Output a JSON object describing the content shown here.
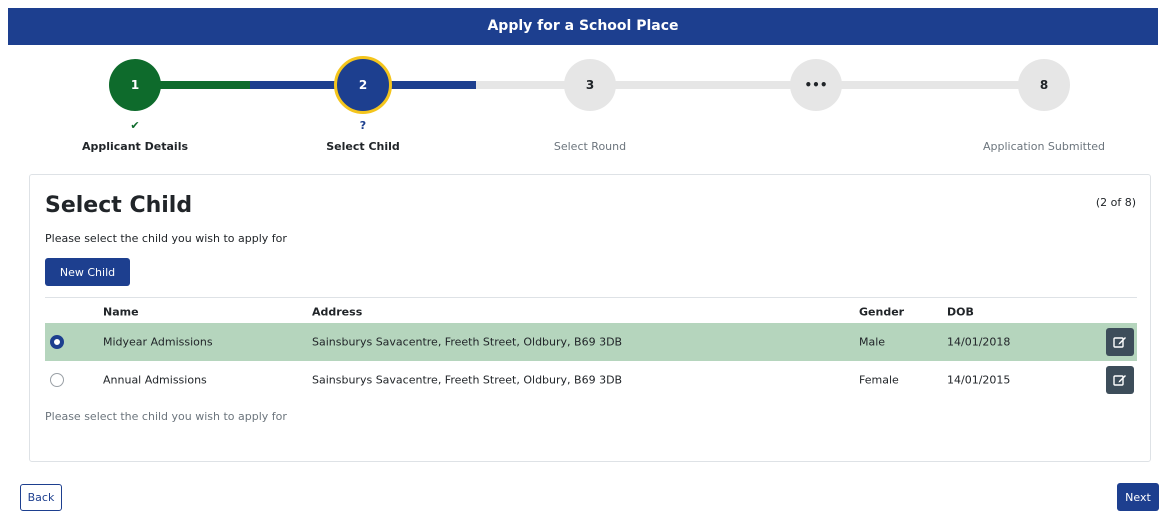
{
  "header": {
    "title": "Apply for a School Place"
  },
  "stepper": {
    "steps": [
      {
        "number": "1",
        "label": "Applicant Details",
        "status_mark": "✔"
      },
      {
        "number": "2",
        "label": "Select Child",
        "status_mark": "?"
      },
      {
        "number": "3",
        "label": "Select Round",
        "status_mark": ""
      },
      {
        "number": "•••",
        "label": "",
        "status_mark": ""
      },
      {
        "number": "8",
        "label": "Application Submitted",
        "status_mark": ""
      }
    ],
    "colors": {
      "done": "#0e6b2c",
      "current": "#1d3f8f",
      "current_ring": "#f4c51d",
      "todo": "#e6e6e6"
    }
  },
  "card": {
    "title": "Select Child",
    "counter": "(2 of 8)",
    "subtitle": "Please select the child you wish to apply for",
    "new_child_label": "New Child",
    "hint": "Please select the child you wish to apply for"
  },
  "table": {
    "headers": {
      "name": "Name",
      "address": "Address",
      "gender": "Gender",
      "dob": "DOB"
    },
    "rows": [
      {
        "name": "Midyear Admissions",
        "address": "Sainsburys Savacentre, Freeth Street, Oldbury, B69 3DB",
        "gender": "Male",
        "dob": "14/01/2018",
        "selected": true
      },
      {
        "name": "Annual Admissions",
        "address": "Sainsburys Savacentre, Freeth Street, Oldbury, B69 3DB",
        "gender": "Female",
        "dob": "14/01/2015",
        "selected": false
      }
    ],
    "edit_icon": "edit-icon"
  },
  "footer": {
    "back_label": "Back",
    "next_label": "Next"
  }
}
